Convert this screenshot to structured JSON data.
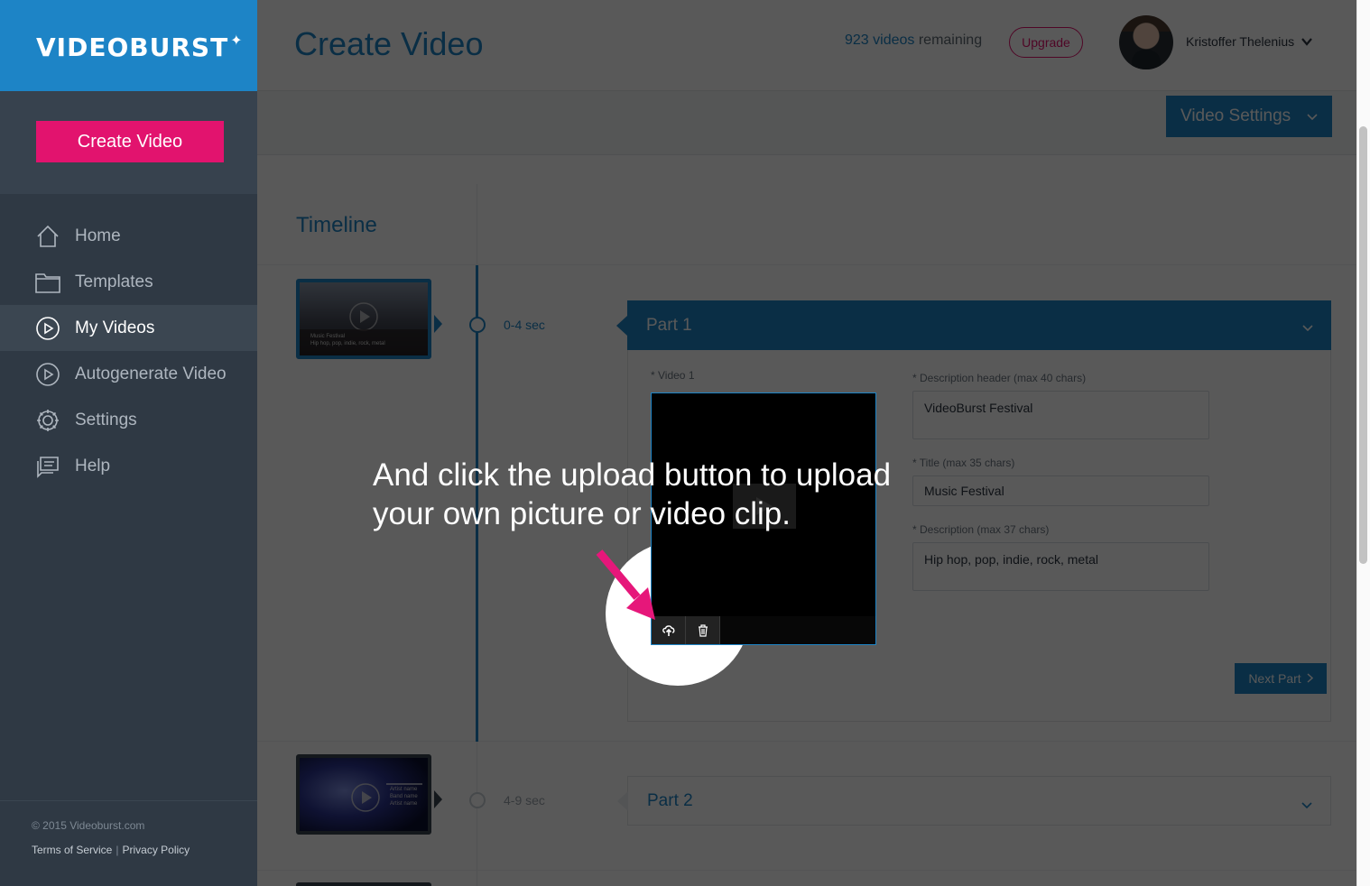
{
  "app": {
    "logo_text": "VIDEOBURST",
    "logo_star": "✦"
  },
  "sidebar": {
    "create_button": "Create Video",
    "items": [
      {
        "label": "Home",
        "icon": "home-icon",
        "active": false
      },
      {
        "label": "Templates",
        "icon": "folder-icon",
        "active": false
      },
      {
        "label": "My Videos",
        "icon": "play-circle-icon",
        "active": true
      },
      {
        "label": "Autogenerate Video",
        "icon": "play-circle-icon",
        "active": false
      },
      {
        "label": "Settings",
        "icon": "gear-icon",
        "active": false
      },
      {
        "label": "Help",
        "icon": "help-chat-icon",
        "active": false
      }
    ],
    "copyright": "© 2015 Videoburst.com",
    "terms": "Terms of Service",
    "privacy": "Privacy Policy"
  },
  "header": {
    "title": "Create Video",
    "remaining_count": "923 videos",
    "remaining_suffix": "remaining",
    "upgrade": "Upgrade",
    "user_name": "Kristoffer Thelenius"
  },
  "toolbar": {
    "video_settings": "Video Settings"
  },
  "timeline": {
    "title": "Timeline",
    "parts": [
      {
        "time": "0-4 sec",
        "label": "Part 1",
        "expanded": true,
        "thumb_caption_1": "Music Festival",
        "thumb_caption_2": "Hip hop, pop, indie, rock, metal",
        "video_label": "* Video 1",
        "desc_header_label": "* Description header (max 40 chars)",
        "desc_header_value": "VideoBurst Festival",
        "title_label": "* Title (max 35 chars)",
        "title_value": "Music Festival",
        "desc_label": "* Description (max 37 chars)",
        "desc_value": "Hip hop, pop, indie, rock, metal",
        "next_button": "Next Part"
      },
      {
        "time": "4-9 sec",
        "label": "Part 2",
        "expanded": false,
        "thumb_caption_1": "Artist name",
        "thumb_caption_2": "Band name",
        "thumb_caption_3": "Artist name"
      }
    ]
  },
  "tutorial": {
    "message": "And click the upload button to upload your own picture or video clip."
  },
  "colors": {
    "brand_blue": "#1d84c6",
    "accent_pink": "#e2136e",
    "sidebar_bg": "#2f3944"
  }
}
